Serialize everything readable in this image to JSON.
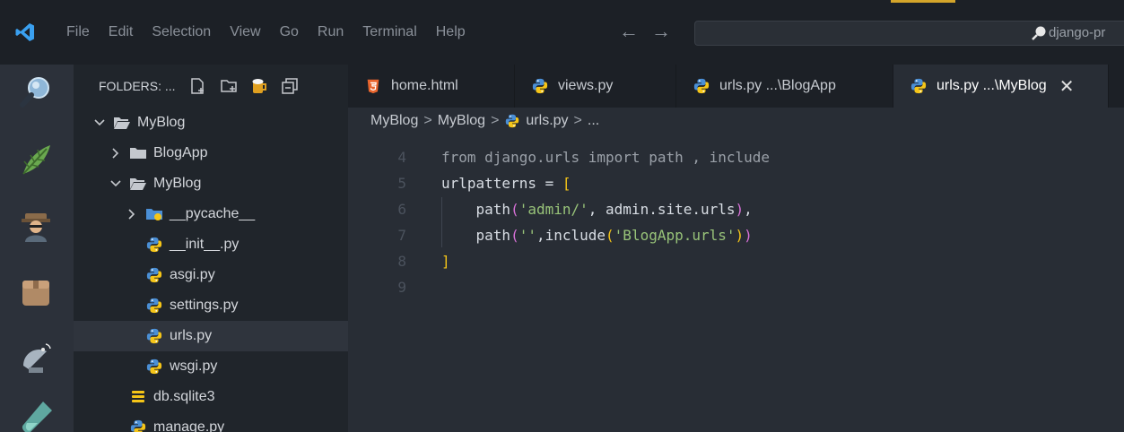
{
  "menu": [
    "File",
    "Edit",
    "Selection",
    "View",
    "Go",
    "Run",
    "Terminal",
    "Help"
  ],
  "search": {
    "text": "django-pr"
  },
  "sidebar": {
    "title": "FOLDERS: ...",
    "tree": [
      {
        "label": "MyBlog",
        "depth": 0,
        "kind": "folder-open",
        "chevron": "down"
      },
      {
        "label": "BlogApp",
        "depth": 1,
        "kind": "folder",
        "chevron": "right"
      },
      {
        "label": "MyBlog",
        "depth": 1,
        "kind": "folder-open",
        "chevron": "down"
      },
      {
        "label": "__pycache__",
        "depth": 2,
        "kind": "folder-py",
        "chevron": "right"
      },
      {
        "label": "__init__.py",
        "depth": 2,
        "kind": "python"
      },
      {
        "label": "asgi.py",
        "depth": 2,
        "kind": "python"
      },
      {
        "label": "settings.py",
        "depth": 2,
        "kind": "python"
      },
      {
        "label": "urls.py",
        "depth": 2,
        "kind": "python",
        "selected": true
      },
      {
        "label": "wsgi.py",
        "depth": 2,
        "kind": "python"
      },
      {
        "label": "db.sqlite3",
        "depth": 1,
        "kind": "db"
      },
      {
        "label": "manage.py",
        "depth": 1,
        "kind": "python"
      }
    ]
  },
  "tabs": [
    {
      "label": "home.html",
      "kind": "html"
    },
    {
      "label": "views.py",
      "kind": "python"
    },
    {
      "label": "urls.py ...\\BlogApp",
      "kind": "python"
    },
    {
      "label": "urls.py ...\\MyBlog",
      "kind": "python",
      "active": true,
      "close": "✕"
    }
  ],
  "breadcrumb": {
    "items": [
      "MyBlog",
      "MyBlog",
      "urls.py",
      "..."
    ],
    "sep": ">"
  },
  "editor": {
    "partial_line": "from django.urls import path , include",
    "lines": [
      {
        "n": "4",
        "code": []
      },
      {
        "n": "5",
        "code": [
          {
            "t": "urlpatterns = ",
            "c": "t-plain"
          },
          {
            "t": "[",
            "c": "t-bracket"
          }
        ]
      },
      {
        "n": "6",
        "code": [
          {
            "t": "    path",
            "c": "t-plain"
          },
          {
            "t": "(",
            "c": "t-paren"
          },
          {
            "t": "'admin/'",
            "c": "t-string"
          },
          {
            "t": ", admin.site.urls",
            "c": "t-plain"
          },
          {
            "t": ")",
            "c": "t-paren"
          },
          {
            "t": ",",
            "c": "t-plain"
          }
        ]
      },
      {
        "n": "7",
        "code": [
          {
            "t": "    path",
            "c": "t-plain"
          },
          {
            "t": "(",
            "c": "t-paren"
          },
          {
            "t": "''",
            "c": "t-string"
          },
          {
            "t": ",include",
            "c": "t-plain"
          },
          {
            "t": "(",
            "c": "t-bracket"
          },
          {
            "t": "'BlogApp.urls'",
            "c": "t-string"
          },
          {
            "t": ")",
            "c": "t-bracket"
          },
          {
            "t": ")",
            "c": "t-paren"
          }
        ]
      },
      {
        "n": "8",
        "code": [
          {
            "t": "]",
            "c": "t-bracket"
          }
        ]
      },
      {
        "n": "9",
        "code": []
      }
    ]
  },
  "colors": {
    "accent": "#d4a52a",
    "bg": "#282d35",
    "sidebar": "#20252b",
    "selection": "#2f343d"
  }
}
